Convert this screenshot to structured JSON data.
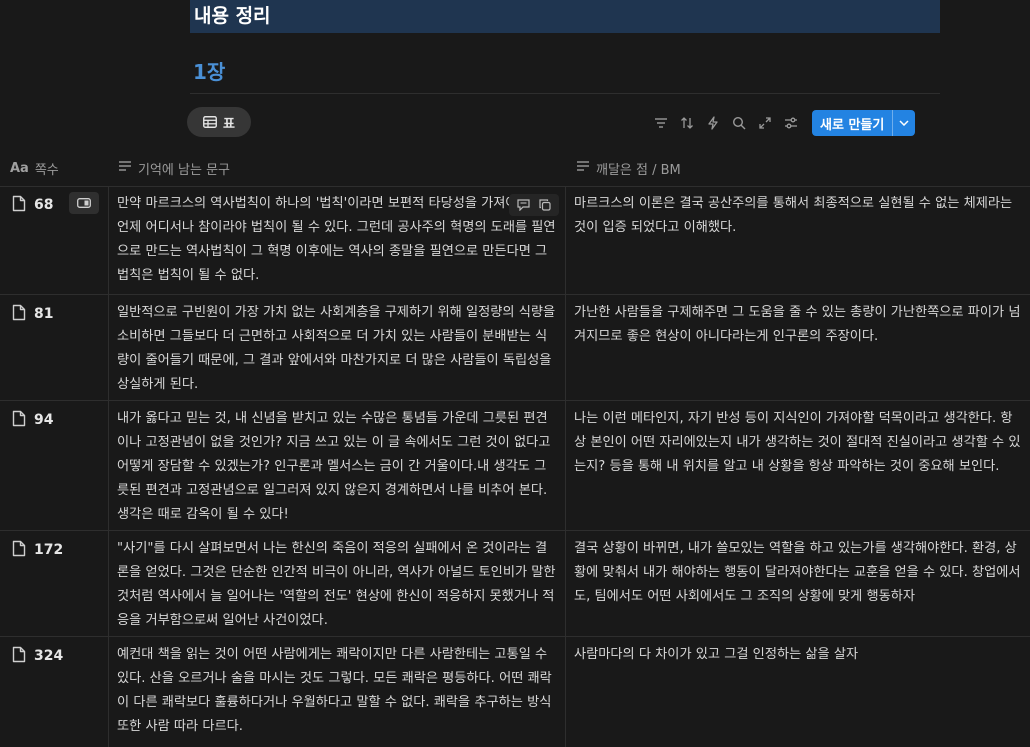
{
  "page": {
    "title": "내용 정리",
    "section": "1장"
  },
  "view": {
    "label": "표",
    "icon": "table-icon"
  },
  "toolbar": {
    "icons": [
      "filter-icon",
      "sort-icon",
      "automation-icon",
      "search-icon",
      "expand-icon",
      "settings-icon"
    ],
    "new_label": "새로 만들기"
  },
  "columns": {
    "page_no": {
      "label": "쪽수",
      "icon": "Aa"
    },
    "quote": {
      "label": "기억에 남는 문구"
    },
    "insight": {
      "label": "깨달은 점 / BM"
    }
  },
  "rows": [
    {
      "page": "68",
      "quote": "만약 마르크스의 역사법칙이 하나의 '법칙'이라면 보편적 타당성을 가져야 한다. 언제 어디서나 참이라야 법칙이 될 수 있다. 그런데 공사주의 혁명의 도래를 필연으로 만드는 역사법칙이 그 혁명 이후에는 역사의 종말을 필연으로 만든다면 그 법칙은 법칙이 될 수 없다.",
      "insight": "마르크스의 이론은 결국 공산주의를 통해서 최종적으로 실현될 수 없는 체제라는 것이 입증 되었다고 이해했다."
    },
    {
      "page": "81",
      "quote": "일반적으로 구빈원이 가장 가치 없는 사회계층을 구제하기 위해 일정량의 식량을 소비하면 그들보다 더 근면하고 사회적으로 더 가치 있는 사람들이 분배받는 식량이 줄어들기 때문에, 그 결과 앞에서와 마찬가지로 더 많은 사람들이 독립성을 상실하게 된다.",
      "insight": "가난한 사람들을 구제해주면 그 도움을 줄 수 있는 총량이 가난한쪽으로 파이가 넘겨지므로 좋은 현상이 아니다라는게 인구론의 주장이다."
    },
    {
      "page": "94",
      "quote": "내가 옳다고 믿는 것, 내 신념을 받치고 있는 수많은 통념들 가운데 그릇된 편견이나 고정관념이 없을 것인가? 지금 쓰고 있는 이 글 속에서도 그런 것이 없다고 어떻게 장담할 수 있겠는가? 인구론과 멜서스는 금이 간 거울이다.내 생각도 그릇된 편견과 고정관념으로 일그러져 있지 않은지 경계하면서 나를 비추어 본다. 생각은 때로 감옥이 될 수 있다!",
      "insight": "나는 이런 메타인지, 자기 반성 등이 지식인이 가져야할 덕목이라고 생각한다. 항상 본인이 어떤 자리에있는지 내가 생각하는 것이 절대적 진실이라고 생각할 수 있는지? 등을 통해 내 위치를 알고 내 상황을 항상 파악하는 것이 중요해 보인다."
    },
    {
      "page": "172",
      "quote": "\"사기\"를 다시 살펴보면서 나는 한신의 죽음이 적응의 실패에서 온 것이라는 결론을 얻었다. 그것은 단순한 인간적 비극이 아니라, 역사가 아널드 토인비가 말한 것처럼 역사에서 늘 일어나는 '역할의 전도' 현상에 한신이 적응하지 못했거나 적응을 거부함으로써 일어난 사건이었다.",
      "insight": "결국 상황이 바뀌면, 내가 쓸모있는 역할을 하고 있는가를 생각해야한다. 환경, 상황에 맞춰서 내가 해야하는 행동이 달라져야한다는 교훈을 얻을 수 있다. 창업에서도, 팀에서도 어떤 사회에서도 그 조직의 상황에 맞게 행동하자"
    },
    {
      "page": "324",
      "quote": "예컨대 책을 읽는 것이 어떤 사람에게는 쾌락이지만 다른 사람한테는 고통일 수 있다. 산을 오르거나 술을 마시는 것도 그렇다. 모든 쾌락은 평등하다. 어떤 쾌락이 다른 쾌락보다 훌륭하다거나 우월하다고 말할 수 없다. 쾌락을 추구하는 방식 또한 사람 따라 다르다.",
      "insight": "사람마다의 다 차이가 있고 그걸 인정하는 삶을 살자"
    }
  ]
}
